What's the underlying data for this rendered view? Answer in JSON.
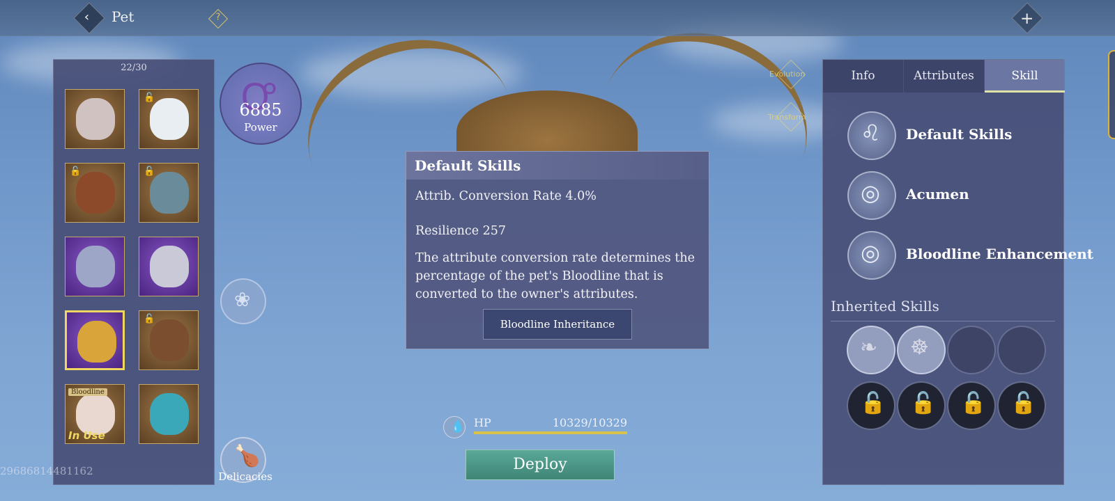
{
  "header": {
    "title": "Pet",
    "back_icon": "‹",
    "help_icon": "?",
    "close_icon": "✕"
  },
  "pet_list": {
    "count": "22/30",
    "slots": [
      {
        "style": "bronze",
        "locked": false,
        "portrait": "#cfc2c0",
        "tag": "",
        "in_use": ""
      },
      {
        "style": "bronze",
        "locked": true,
        "portrait": "#e8eef2",
        "tag": "",
        "in_use": ""
      },
      {
        "style": "bronze",
        "locked": true,
        "portrait": "#8c4a2a",
        "tag": "",
        "in_use": ""
      },
      {
        "style": "bronze",
        "locked": true,
        "portrait": "#6a8c9a",
        "tag": "",
        "in_use": ""
      },
      {
        "style": "purple",
        "locked": false,
        "portrait": "#9ea6c8",
        "tag": "",
        "in_use": ""
      },
      {
        "style": "purple",
        "locked": false,
        "portrait": "#c9c9d8",
        "tag": "",
        "in_use": ""
      },
      {
        "style": "purple",
        "locked": false,
        "portrait": "#d9a43a",
        "tag": "",
        "in_use": "",
        "selected": true
      },
      {
        "style": "bronze",
        "locked": true,
        "portrait": "#7a4e2e",
        "tag": "",
        "in_use": ""
      },
      {
        "style": "bronze",
        "locked": false,
        "portrait": "#e8d8d0",
        "tag": "Bloodline",
        "in_use": "In Use"
      },
      {
        "style": "bronze",
        "locked": false,
        "portrait": "#3aa8b8",
        "tag": "",
        "in_use": ""
      }
    ],
    "lock_icon": "🔓"
  },
  "user_id": "2968681",
  "user_id_full": "29686814481162",
  "power": {
    "value": "6885",
    "label": "Power",
    "glyph": "Ꝍ"
  },
  "side_actions": {
    "evolution": "Evolution",
    "transform": "Transform"
  },
  "spirit_icon": "❀",
  "delicacies": {
    "label": "Delicacies",
    "icon": "🍗"
  },
  "tooltip": {
    "title": "Default Skills",
    "conversion_rate": "Attrib. Conversion Rate 4.0%",
    "resilience": "Resilience 257",
    "description": "The attribute conversion rate determines the percentage of the pet's Bloodline that is converted to the owner's attributes.",
    "button": "Bloodline Inheritance"
  },
  "hp": {
    "label": "HP",
    "value": "10329/10329",
    "fraction": 1.0,
    "icon": "💧"
  },
  "deploy_label": "Deploy",
  "skill_panel": {
    "tabs": [
      {
        "label": "Info",
        "active": false
      },
      {
        "label": "Attributes",
        "active": false
      },
      {
        "label": "Skill",
        "active": true
      }
    ],
    "skills": [
      {
        "name": "Default Skills",
        "icon": "♌"
      },
      {
        "name": "Acumen",
        "icon": "◎"
      },
      {
        "name": "Bloodline Enhancement",
        "icon": "◎"
      }
    ],
    "inherited_title": "Inherited Skills",
    "inherited_slots": [
      {
        "state": "filled",
        "icon": "❧"
      },
      {
        "state": "filled",
        "icon": "☸"
      },
      {
        "state": "empty",
        "icon": ""
      },
      {
        "state": "empty",
        "icon": ""
      },
      {
        "state": "locked",
        "icon": "🔓"
      },
      {
        "state": "locked",
        "icon": "🔓"
      },
      {
        "state": "locked",
        "icon": "🔓"
      },
      {
        "state": "locked",
        "icon": "🔓"
      }
    ]
  },
  "colors": {
    "accent_gold": "#f0d860",
    "deploy_green": "#4f9a8a",
    "panel": "#484e76"
  }
}
